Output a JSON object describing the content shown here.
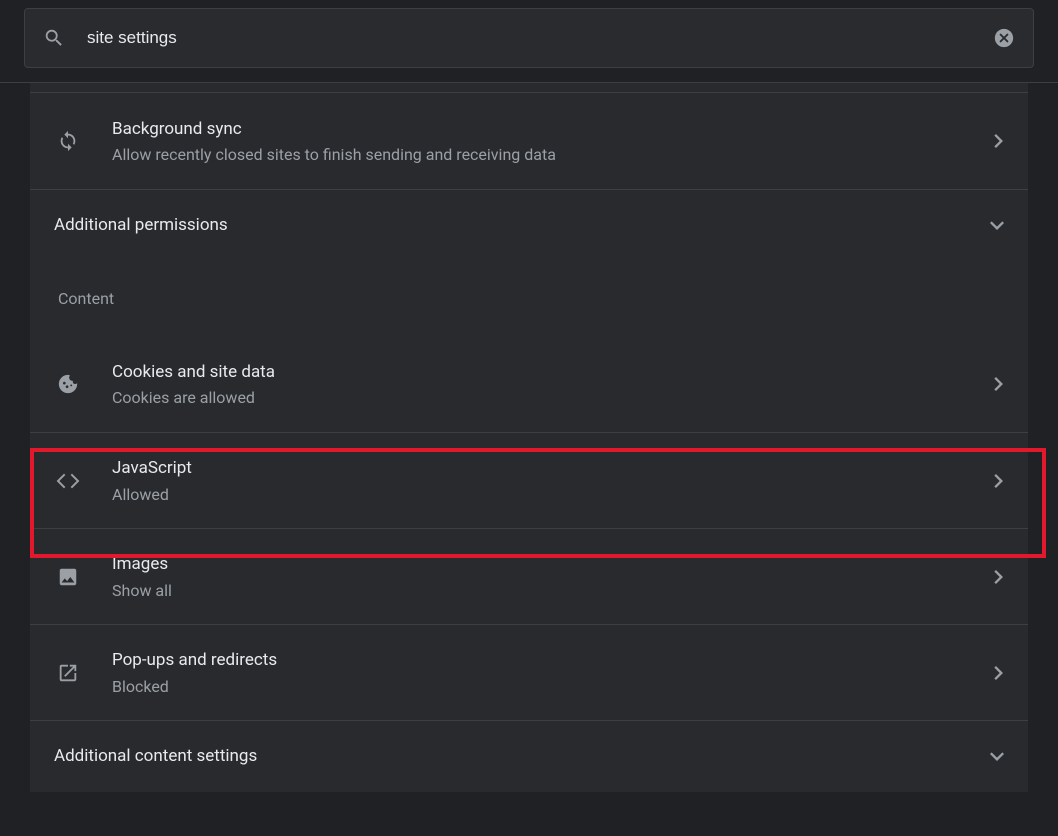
{
  "search": {
    "value": "site settings"
  },
  "rows": {
    "bg_sync": {
      "title": "Background sync",
      "subtitle": "Allow recently closed sites to finish sending and receiving data"
    },
    "add_perms": {
      "title": "Additional permissions"
    },
    "content_header": "Content",
    "cookies": {
      "title": "Cookies and site data",
      "subtitle": "Cookies are allowed"
    },
    "javascript": {
      "title": "JavaScript",
      "subtitle": "Allowed"
    },
    "images": {
      "title": "Images",
      "subtitle": "Show all"
    },
    "popups": {
      "title": "Pop-ups and redirects",
      "subtitle": "Blocked"
    },
    "add_content": {
      "title": "Additional content settings"
    }
  }
}
